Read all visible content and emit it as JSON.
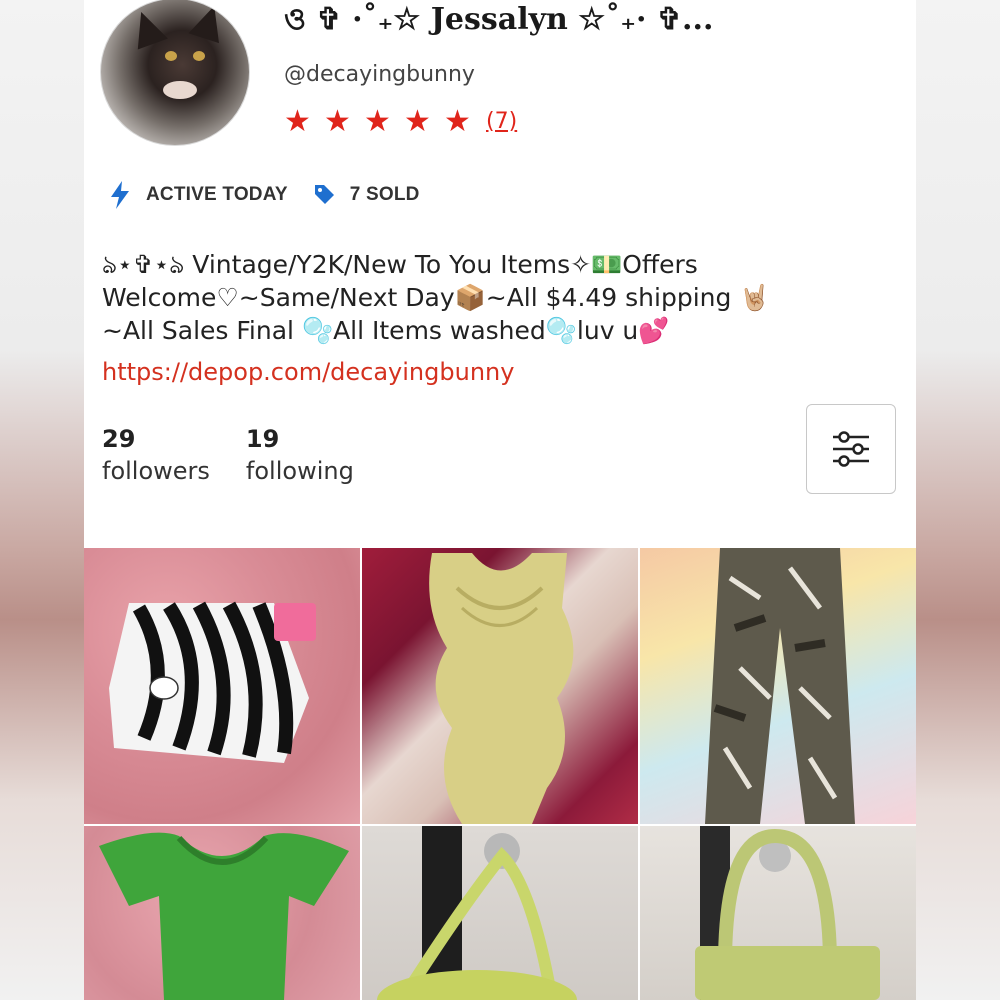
{
  "profile": {
    "display_name": "ও ✞ ·˚₊☆ Jessalyn ☆˚₊· ✞...",
    "username": "@decayingbunny",
    "rating_stars": 5,
    "rating_count": "(7)"
  },
  "meta": {
    "active": "ACTIVE TODAY",
    "sold": "7 SOLD"
  },
  "bio": {
    "line1": "ঌ⋆✞⋆ঌ Vintage/Y2K/New To You Items✧💵Offers",
    "line2": "Welcome♡~Same/Next Day📦~All $4.49 shipping 🤘🏼",
    "line3": "~All Sales Final 🫧All Items washed🫧luv u💕"
  },
  "link": "https://depop.com/decayingbunny",
  "stats": {
    "followers_count": "29",
    "followers_label": "followers",
    "following_count": "19",
    "following_label": "following"
  },
  "icons": {
    "active": "lightning-icon",
    "sold": "tag-icon",
    "filter": "sliders-icon"
  },
  "colors": {
    "accent_red": "#e0251b",
    "link_red": "#d4311f",
    "icon_blue": "#1f6fcf"
  },
  "grid_items": [
    {
      "item": "zebra-print-skirt"
    },
    {
      "item": "yellow-ruffle-top"
    },
    {
      "item": "camo-pants"
    },
    {
      "item": "green-ruched-top"
    },
    {
      "item": "green-shoulder-bag"
    },
    {
      "item": "green-croc-handbag"
    }
  ]
}
